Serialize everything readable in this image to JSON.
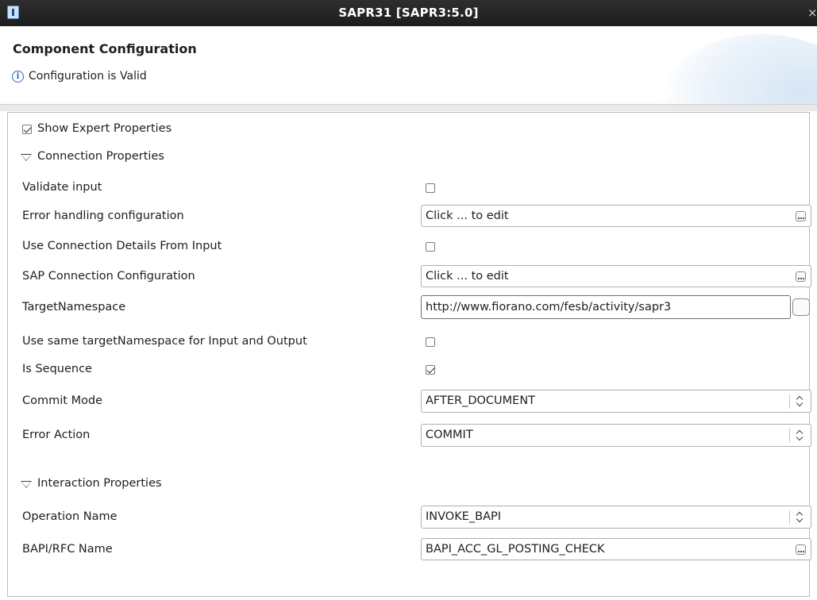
{
  "window": {
    "title": "SAPR31 [SAPR3:5.0]",
    "close_glyph": "×"
  },
  "header": {
    "title": "Component Configuration",
    "status": "Configuration is Valid",
    "status_icon": "info-icon"
  },
  "expert": {
    "label": "Show Expert Properties",
    "checked": true
  },
  "connection_section": {
    "label": "Connection Properties",
    "expanded": true,
    "properties": {
      "validate_input": {
        "label": "Validate input",
        "checked": false
      },
      "error_handling": {
        "label": "Error handling configuration",
        "value": "Click ... to edit"
      },
      "use_connection_details": {
        "label": "Use Connection Details From Input",
        "checked": false
      },
      "sap_connection": {
        "label": "SAP Connection Configuration",
        "value": "Click ... to edit"
      },
      "target_namespace": {
        "label": "TargetNamespace",
        "value": "http://www.fiorano.com/fesb/activity/sapr3"
      },
      "same_namespace": {
        "label": "Use same targetNamespace for Input and Output",
        "checked": false
      },
      "is_sequence": {
        "label": "Is Sequence",
        "checked": true
      },
      "commit_mode": {
        "label": "Commit Mode",
        "value": "AFTER_DOCUMENT"
      },
      "error_action": {
        "label": "Error Action",
        "value": "COMMIT"
      }
    }
  },
  "interaction_section": {
    "label": "Interaction Properties",
    "expanded": true,
    "properties": {
      "operation_name": {
        "label": "Operation Name",
        "value": "INVOKE_BAPI"
      },
      "bapi_rfc_name": {
        "label": "BAPI/RFC Name",
        "value": "BAPI_ACC_GL_POSTING_CHECK"
      }
    }
  },
  "colors": {
    "titlebar": "#1d1d1d",
    "info_accent": "#2f66b3",
    "panel_border": "#bdbdbd"
  }
}
